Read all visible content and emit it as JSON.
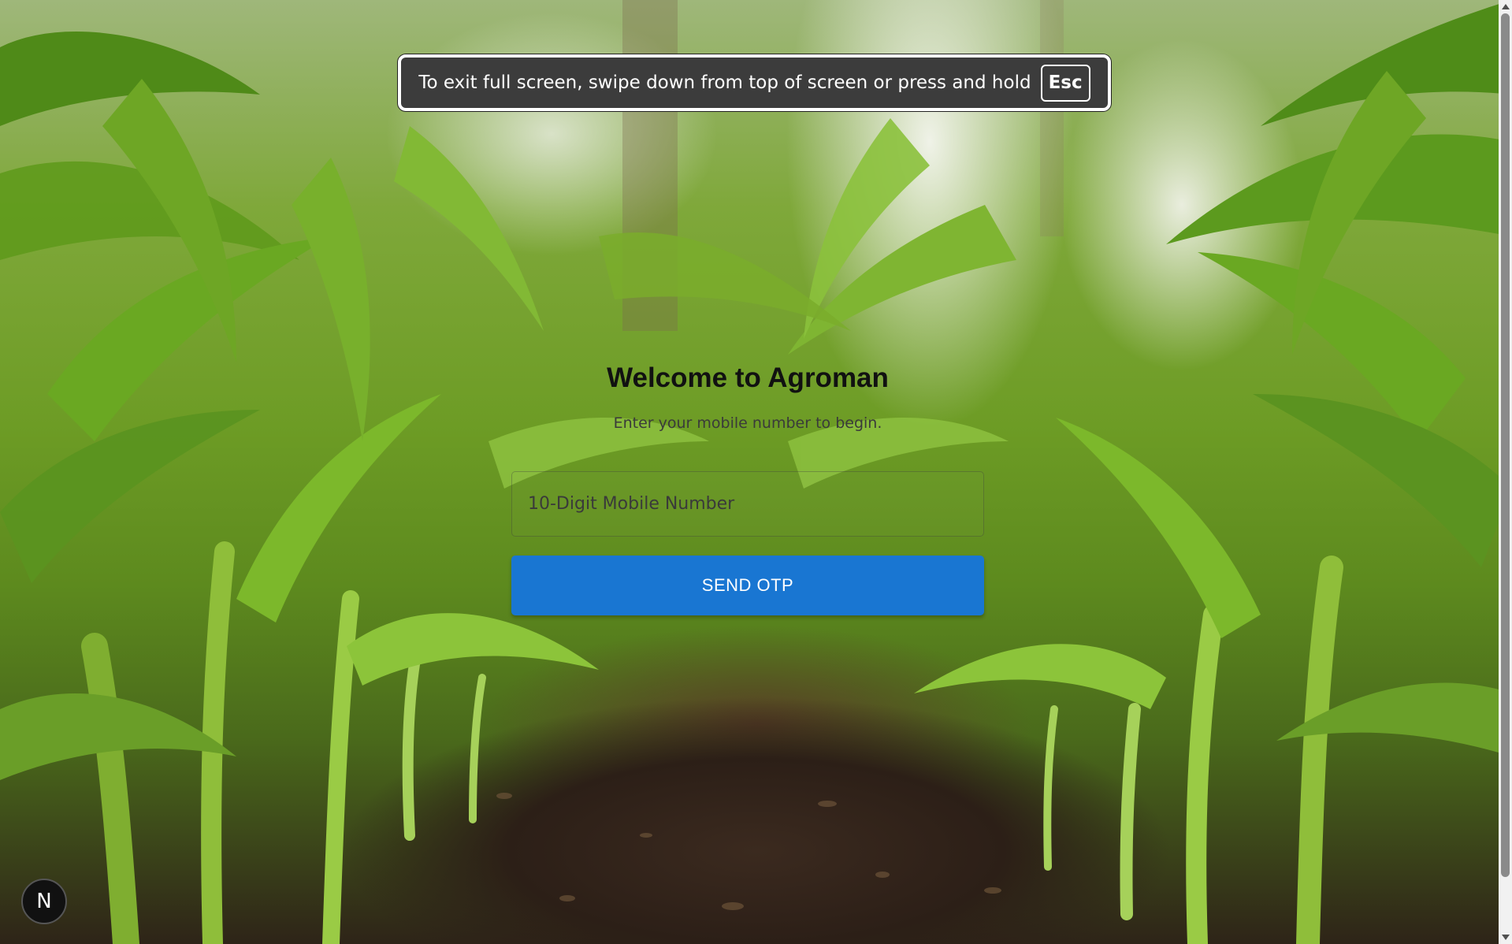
{
  "fullscreen_notice": {
    "message": "To exit full screen, swipe down from top of screen or press and hold",
    "key": "Esc"
  },
  "login": {
    "title": "Welcome to Agroman",
    "subtitle": "Enter your mobile number to begin.",
    "mobile_placeholder": "10-Digit Mobile Number",
    "mobile_value": "",
    "send_otp_label": "SEND OTP"
  },
  "dev_badge": {
    "letter": "N",
    "icon": "nextjs-logo-icon"
  },
  "colors": {
    "primary": "#1976d2",
    "toast_bg": "#3c3c3c",
    "title": "#111111"
  },
  "background": {
    "icon": "corn-field-photo"
  }
}
